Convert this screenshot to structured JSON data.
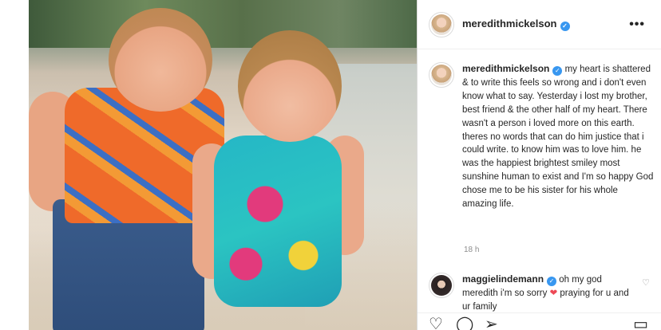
{
  "post": {
    "username": "meredithmickelson",
    "more_label": "•••"
  },
  "caption": {
    "username": "meredithmickelson",
    "text": "my heart is shattered & to write this feels so wrong and i don't even know what to say. Yesterday i lost my brother, best friend & the other half of my heart. There wasn't a person i loved more on this earth. theres no words that can do him justice that i could write. to know him was to love him. he was the happiest brightest smiley most sunshine human to exist and I'm so happy God chose me to be his sister for his whole amazing life.",
    "time": "18 h"
  },
  "comment": {
    "username": "maggielindemann",
    "text_before": "oh my god meredith i'm so sorry",
    "text_after": "praying for u and ur family"
  },
  "icons": {
    "verified": "verified-badge-icon",
    "more": "more-options-icon",
    "like": "heart-icon",
    "comment": "comment-icon",
    "share": "send-icon",
    "save": "bookmark-icon",
    "comment_like": "heart-outline-icon"
  },
  "colors": {
    "verified_blue": "#3897f0",
    "heart_red": "#ed4956",
    "muted_gray": "#8e8e8e"
  }
}
